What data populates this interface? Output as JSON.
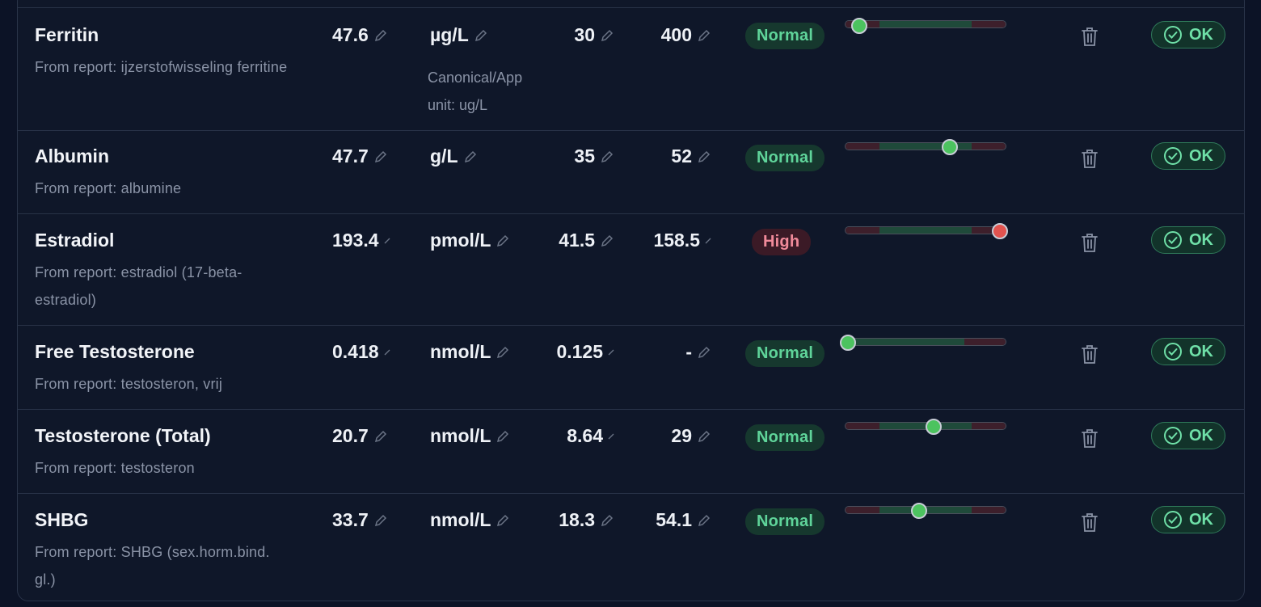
{
  "rows": [
    {
      "name": "Ferritin",
      "source": "From report: ijzerstofwisseling ferritine",
      "value": "47.6",
      "unit": "µg/L",
      "canonical": "Canonical/App unit: ug/L",
      "low": "30",
      "high": "400",
      "status": "Normal",
      "level": 0.09,
      "ok": "OK"
    },
    {
      "name": "Albumin",
      "source": "From report: albumine",
      "value": "47.7",
      "unit": "g/L",
      "canonical": "",
      "low": "35",
      "high": "52",
      "status": "Normal",
      "level": 0.65,
      "ok": "OK"
    },
    {
      "name": "Estradiol",
      "source": "From report: estradiol (17-beta-estradiol)",
      "value": "193.4",
      "unit": "pmol/L",
      "canonical": "",
      "low": "41.5",
      "high": "158.5",
      "status": "High",
      "level": 0.96,
      "ok": "OK"
    },
    {
      "name": "Free Testosterone",
      "source": "From report: testosteron, vrij",
      "value": "0.418",
      "unit": "nmol/L",
      "canonical": "",
      "low": "0.125",
      "high": "-",
      "status": "Normal",
      "level": 0.02,
      "ok": "OK"
    },
    {
      "name": "Testosterone (Total)",
      "source": "From report: testosteron",
      "value": "20.7",
      "unit": "nmol/L",
      "canonical": "",
      "low": "8.64",
      "high": "29",
      "status": "Normal",
      "level": 0.55,
      "ok": "OK"
    },
    {
      "name": "SHBG",
      "source": "From report: SHBG (sex.horm.bind. gl.)",
      "value": "33.7",
      "unit": "nmol/L",
      "canonical": "",
      "low": "18.3",
      "high": "54.1",
      "status": "Normal",
      "level": 0.46,
      "ok": "OK"
    }
  ],
  "icons": {
    "edit": "pencil-icon",
    "delete": "trash-icon",
    "confirm": "check-circle-icon"
  },
  "colors": {
    "background": "#0c1326",
    "normal_text": "#5fd49a",
    "high_text": "#f08a9a",
    "track_green": "#1f4a3a",
    "track_red": "#3d1f2b",
    "dot_green": "#4cc35f",
    "dot_red": "#e2534f"
  }
}
